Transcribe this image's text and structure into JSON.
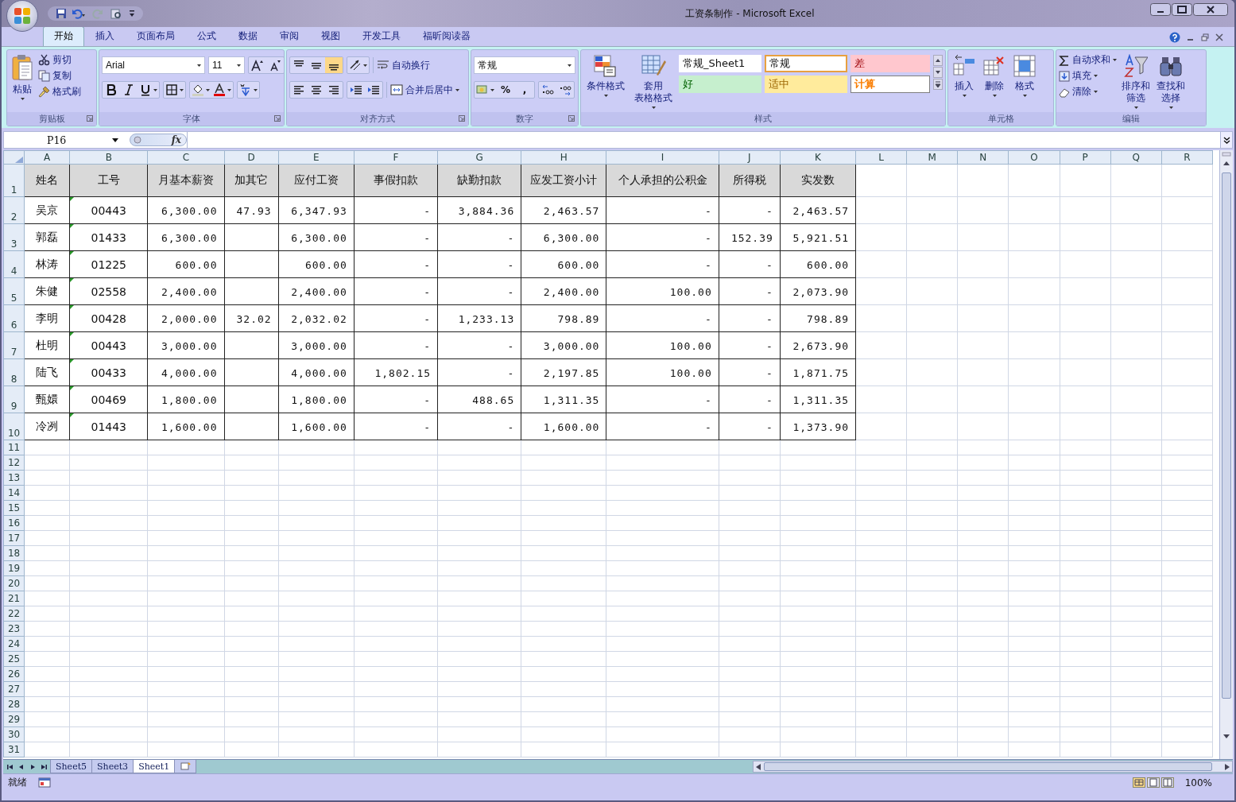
{
  "window": {
    "title": "工资条制作 - Microsoft Excel"
  },
  "tabs": [
    {
      "label": "开始",
      "selected": true
    },
    {
      "label": "插入",
      "selected": false
    },
    {
      "label": "页面布局",
      "selected": false
    },
    {
      "label": "公式",
      "selected": false
    },
    {
      "label": "数据",
      "selected": false
    },
    {
      "label": "审阅",
      "selected": false
    },
    {
      "label": "视图",
      "selected": false
    },
    {
      "label": "开发工具",
      "selected": false
    },
    {
      "label": "福昕阅读器",
      "selected": false
    }
  ],
  "ribbon": {
    "clipboard": {
      "label": "剪贴板",
      "paste": "粘贴",
      "items": [
        "剪切",
        "复制",
        "格式刷"
      ]
    },
    "font": {
      "label": "字体",
      "font_name": "Arial",
      "font_size": "11"
    },
    "alignment": {
      "label": "对齐方式",
      "wrap": "自动换行",
      "merge": "合并后居中"
    },
    "number": {
      "label": "数字",
      "format": "常规",
      "percent": "%",
      "comma": ","
    },
    "styles": {
      "label": "样式",
      "buttons": [
        {
          "lines": [
            "条件格式"
          ]
        },
        {
          "lines": [
            "套用",
            "表格格式"
          ]
        }
      ],
      "cells": [
        {
          "text": "常规_Sheet1",
          "kind": "normal",
          "selected": false
        },
        {
          "text": "常规",
          "kind": "normal",
          "selected": true
        },
        {
          "text": "差",
          "kind": "bad",
          "selected": false
        },
        {
          "text": "好",
          "kind": "good",
          "selected": false
        },
        {
          "text": "适中",
          "kind": "neutral",
          "selected": false
        },
        {
          "text": "计算",
          "kind": "calc",
          "selected": false
        }
      ]
    },
    "cells": {
      "label": "单元格",
      "buttons": [
        "插入",
        "删除",
        "格式"
      ]
    },
    "editing": {
      "label": "编辑",
      "items": [
        "自动求和",
        "填充",
        "清除"
      ],
      "buttons": [
        {
          "lines": [
            "排序和",
            "筛选"
          ]
        },
        {
          "lines": [
            "查找和",
            "选择"
          ]
        }
      ]
    }
  },
  "formula_bar": {
    "name_box": "P16",
    "fx": "fx"
  },
  "columns": [
    "A",
    "B",
    "C",
    "D",
    "E",
    "F",
    "G",
    "H",
    "I",
    "J",
    "K",
    "L",
    "M",
    "N",
    "O",
    "P",
    "Q",
    "R"
  ],
  "rows": [
    {
      "number": "1",
      "kind": "header",
      "cells": [
        "姓名",
        "工号",
        "月基本薪资",
        "加其它",
        "应付工资",
        "事假扣款",
        "缺勤扣款",
        "应发工资小计",
        "个人承担的公积金",
        "所得税",
        "实发数"
      ]
    },
    {
      "number": "2",
      "kind": "data",
      "flag": true,
      "cells": [
        "吴京",
        "00443",
        "6,300.00",
        "47.93",
        "6,347.93",
        "-",
        "3,884.36",
        "2,463.57",
        "-",
        "-",
        "2,463.57"
      ]
    },
    {
      "number": "3",
      "kind": "data",
      "flag": true,
      "cells": [
        "郭磊",
        "01433",
        "6,300.00",
        null,
        "6,300.00",
        "-",
        "-",
        "6,300.00",
        "-",
        "152.39",
        "5,921.51"
      ]
    },
    {
      "number": "4",
      "kind": "data",
      "flag": true,
      "cells": [
        "林涛",
        "01225",
        "600.00",
        null,
        "600.00",
        "-",
        "-",
        "600.00",
        "-",
        "-",
        "600.00"
      ]
    },
    {
      "number": "5",
      "kind": "data",
      "flag": true,
      "cells": [
        "朱健",
        "02558",
        "2,400.00",
        null,
        "2,400.00",
        "-",
        "-",
        "2,400.00",
        "100.00",
        "-",
        "2,073.90"
      ]
    },
    {
      "number": "6",
      "kind": "data",
      "flag": true,
      "cells": [
        "李明",
        "00428",
        "2,000.00",
        "32.02",
        "2,032.02",
        "-",
        "1,233.13",
        "798.89",
        "-",
        "-",
        "798.89"
      ]
    },
    {
      "number": "7",
      "kind": "data",
      "flag": true,
      "cells": [
        "杜明",
        "00443",
        "3,000.00",
        null,
        "3,000.00",
        "-",
        "-",
        "3,000.00",
        "100.00",
        "-",
        "2,673.90"
      ]
    },
    {
      "number": "8",
      "kind": "data",
      "flag": true,
      "cells": [
        "陆飞",
        "00433",
        "4,000.00",
        null,
        "4,000.00",
        "1,802.15",
        "-",
        "2,197.85",
        "100.00",
        "-",
        "1,871.75"
      ]
    },
    {
      "number": "9",
      "kind": "data",
      "flag": true,
      "cells": [
        "甄嬛",
        "00469",
        "1,800.00",
        null,
        "1,800.00",
        "-",
        "488.65",
        "1,311.35",
        "-",
        "-",
        "1,311.35"
      ]
    },
    {
      "number": "10",
      "kind": "data",
      "flag": true,
      "cells": [
        "冷冽",
        "01443",
        "1,600.00",
        null,
        "1,600.00",
        "-",
        "-",
        "1,600.00",
        "-",
        "-",
        "1,373.90"
      ]
    },
    {
      "number": "11"
    },
    {
      "number": "12"
    },
    {
      "number": "13"
    },
    {
      "number": "14"
    },
    {
      "number": "15"
    },
    {
      "number": "16"
    },
    {
      "number": "17"
    },
    {
      "number": "18"
    },
    {
      "number": "19"
    },
    {
      "number": "20"
    },
    {
      "number": "21"
    },
    {
      "number": "22"
    },
    {
      "number": "23"
    },
    {
      "number": "24"
    },
    {
      "number": "25"
    },
    {
      "number": "26"
    },
    {
      "number": "27"
    },
    {
      "number": "28"
    },
    {
      "number": "29"
    },
    {
      "number": "30"
    },
    {
      "number": "31"
    }
  ],
  "sheet_tabs": [
    {
      "label": "Sheet5",
      "selected": false
    },
    {
      "label": "Sheet3",
      "selected": false
    },
    {
      "label": "Sheet1",
      "selected": true
    }
  ],
  "status_bar": {
    "status": "就绪",
    "zoom": "100%"
  }
}
